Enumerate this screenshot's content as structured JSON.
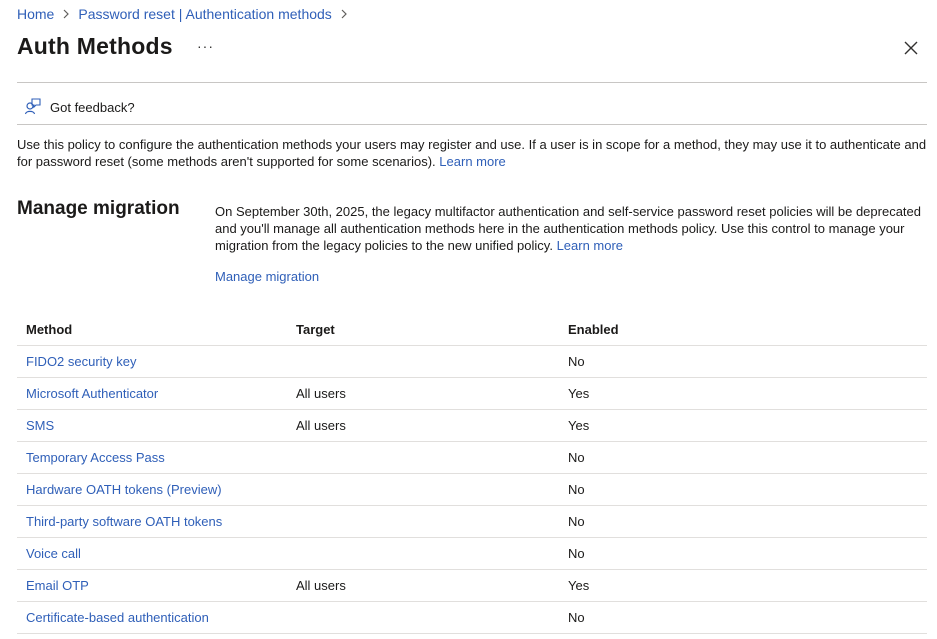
{
  "breadcrumb": {
    "items": [
      "Home",
      "Password reset | Authentication methods"
    ]
  },
  "header": {
    "title": "Auth Methods",
    "more_label": "···"
  },
  "feedback": {
    "label": "Got feedback?"
  },
  "policy": {
    "description": "Use this policy to configure the authentication methods your users may register and use. If a user is in scope for a method, they may use it to authenticate and for password reset (some methods aren't supported for some scenarios).",
    "learn_more": "Learn more"
  },
  "migration": {
    "heading": "Manage migration",
    "description": "On September 30th, 2025, the legacy multifactor authentication and self-service password reset policies will be deprecated and you'll manage all authentication methods here in the authentication methods policy. Use this control to manage your migration from the legacy policies to the new unified policy.",
    "learn_more": "Learn more",
    "manage_link": "Manage migration"
  },
  "table": {
    "columns": [
      "Method",
      "Target",
      "Enabled"
    ],
    "rows": [
      {
        "method": "FIDO2 security key",
        "target": "",
        "enabled": "No"
      },
      {
        "method": "Microsoft Authenticator",
        "target": "All users",
        "enabled": "Yes"
      },
      {
        "method": "SMS",
        "target": "All users",
        "enabled": "Yes"
      },
      {
        "method": "Temporary Access Pass",
        "target": "",
        "enabled": "No"
      },
      {
        "method": "Hardware OATH tokens (Preview)",
        "target": "",
        "enabled": "No"
      },
      {
        "method": "Third-party software OATH tokens",
        "target": "",
        "enabled": "No"
      },
      {
        "method": "Voice call",
        "target": "",
        "enabled": "No"
      },
      {
        "method": "Email OTP",
        "target": "All users",
        "enabled": "Yes"
      },
      {
        "method": "Certificate-based authentication",
        "target": "",
        "enabled": "No"
      }
    ]
  },
  "colors": {
    "link": "#2f5fb8",
    "text": "#1b1a19",
    "divider": "#c8c6c4"
  },
  "icons": {
    "chevron": "chevron-right-icon",
    "close": "close-icon",
    "feedback": "feedback-person-icon"
  }
}
